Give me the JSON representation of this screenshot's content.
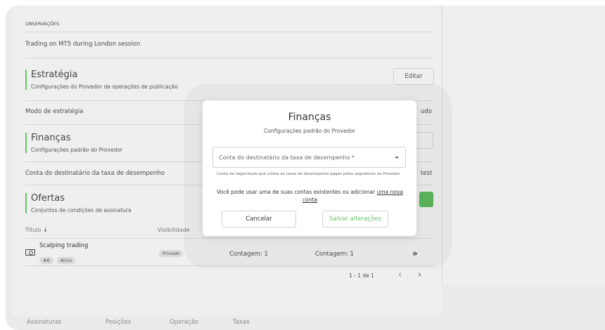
{
  "observacoes": {
    "label": "OBSERVAÇÕES",
    "text": "Trading on MT5 during London session"
  },
  "estrategia": {
    "title": "Estratégia",
    "subtitle": "Configurações do Provedor de operações de publicação",
    "edit_label": "Editar",
    "row_label": "Modo de estratégia",
    "row_value_partial": "udo"
  },
  "financas": {
    "title": "Finanças",
    "subtitle": "Configurações padrão do Provedor",
    "row_label": "Conta do destinatário da taxa de desempenho",
    "row_value_partial": "test"
  },
  "ofertas": {
    "title": "Ofertas",
    "subtitle": "Conjuntos de condições de assinatura"
  },
  "table": {
    "headers": [
      "Título",
      "Visibilidade"
    ],
    "sort_arrow": "↓",
    "row": {
      "name": "Scalping trading",
      "id_badge": "#6",
      "status_badge": "Ativo",
      "visibility": "Privado",
      "count1": "Contagem: 1",
      "count2": "Contagem: 1",
      "chevrons": "»"
    },
    "pagination": "1 - 1 de 1",
    "prev": "‹",
    "next": "›"
  },
  "tabs": [
    "Assinaturas",
    "Posições",
    "Operação",
    "Taxas"
  ],
  "modal": {
    "title": "Finanças",
    "subtitle": "Configurações padrão do Provedor",
    "select_label": "Conta do destinatário da taxa de desempenho *",
    "helper": "Conta de negociação que coleta as taxas de desempenho pagas pelos seguidores ao Provedor",
    "info_text": "Você pode usar uma de suas contas existentes ou adicionar ",
    "info_link": "uma nova conta",
    "cancel_label": "Cancelar",
    "save_label": "Salvar alterações"
  },
  "colors": {
    "accent_green": "#5cb85c",
    "save_text": "#6cc06c"
  }
}
